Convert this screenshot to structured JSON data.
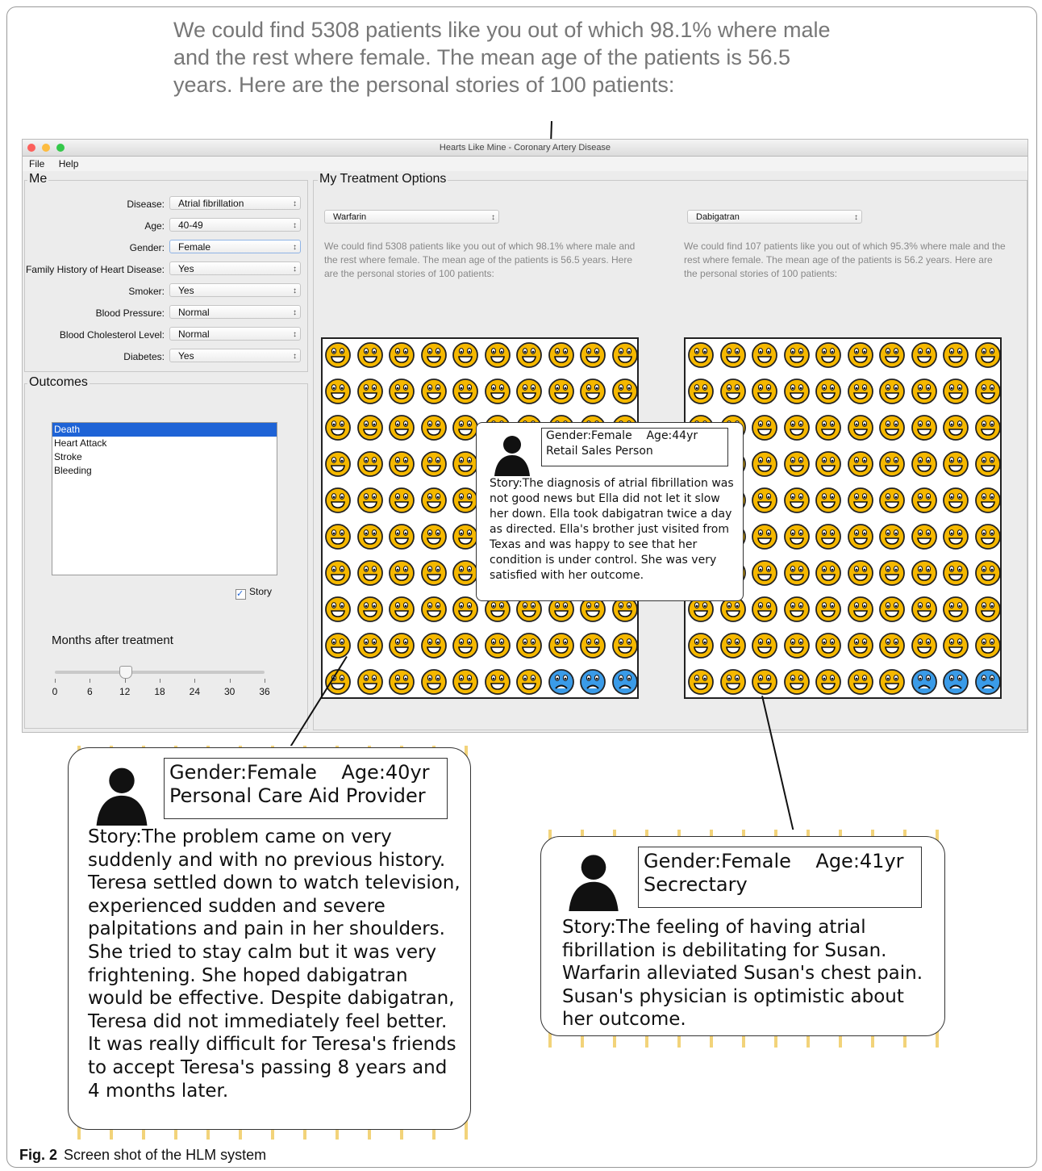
{
  "top_caption": "We could find 5308 patients like you out of which 98.1% where male and the rest where female. The mean age of the patients is 56.5 years. Here are the personal stories of 100 patients:",
  "window": {
    "title": "Hearts Like Mine - Coronary Artery Disease",
    "menu": [
      "File",
      "Help"
    ]
  },
  "me": {
    "legend": "Me",
    "fields": [
      {
        "label": "Disease:",
        "value": "Atrial fibrillation"
      },
      {
        "label": "Age:",
        "value": "40-49"
      },
      {
        "label": "Gender:",
        "value": "Female"
      },
      {
        "label": "Family History of Heart Disease:",
        "value": "Yes"
      },
      {
        "label": "Smoker:",
        "value": "Yes"
      },
      {
        "label": "Blood Pressure:",
        "value": "Normal"
      },
      {
        "label": "Blood Cholesterol Level:",
        "value": "Normal"
      },
      {
        "label": "Diabetes:",
        "value": "Yes"
      }
    ]
  },
  "outcomes": {
    "legend": "Outcomes",
    "items": [
      "Death",
      "Heart Attack",
      "Stroke",
      "Bleeding"
    ],
    "selected": "Death",
    "story_label": "Story",
    "story_checked": true,
    "months_label": "Months after treatment",
    "slider_ticks": [
      "0",
      "6",
      "12",
      "18",
      "24",
      "30",
      "36"
    ],
    "slider_value": 12
  },
  "treatment": {
    "legend": "My Treatment Options",
    "left": {
      "drug": "Warfarin",
      "text": "We could find 5308 patients like you out of which 98.1% where male and the rest where female. The mean age of the patients is 56.5 years. Here are the personal stories of 100 patients:",
      "sad_count": 3
    },
    "right": {
      "drug": "Dabigatran",
      "text": "We could find 107 patients like you out of which 95.3% where male and the rest where female. The mean age of the patients is 56.2 years. Here are the personal stories of 100 patients:",
      "sad_count": 3
    }
  },
  "bubbles": {
    "ella": {
      "header": "Gender:Female    Age:44yr",
      "occupation": "Retail Sales Person",
      "story": "Story:The diagnosis of atrial fibrillation was not good news but Ella did not let it slow her down.  Ella took dabigatran twice a day as directed. Ella's brother just visited from Texas and was happy to see that her condition is under control. She was very satisfied with her outcome."
    },
    "teresa": {
      "header": "Gender:Female    Age:40yr",
      "occupation": "Personal Care Aid Provider",
      "story": "Story:The problem came on very suddenly and with no previous history. Teresa settled down to watch television, experienced sudden and severe palpitations and pain in her shoulders. She tried to stay calm but it was very frightening.  She hoped dabigatran would be effective. Despite dabigatran, Teresa did not immediately feel better. It was really difficult for Teresa's friends to accept Teresa's passing 8 years and 4 months later."
    },
    "susan": {
      "header": "Gender:Female    Age:41yr",
      "occupation": "Secrectary",
      "story": "Story:The feeling of having atrial fibrillation is debilitating for Susan. Warfarin alleviated Susan's chest pain. Susan's physician is optimistic about her outcome."
    }
  },
  "figure": {
    "label": "Fig. 2",
    "caption": "Screen shot of the HLM system"
  },
  "colors": {
    "face_yellow": "#f5b800",
    "face_blue": "#3a9be8",
    "selection": "#1e63d6"
  }
}
